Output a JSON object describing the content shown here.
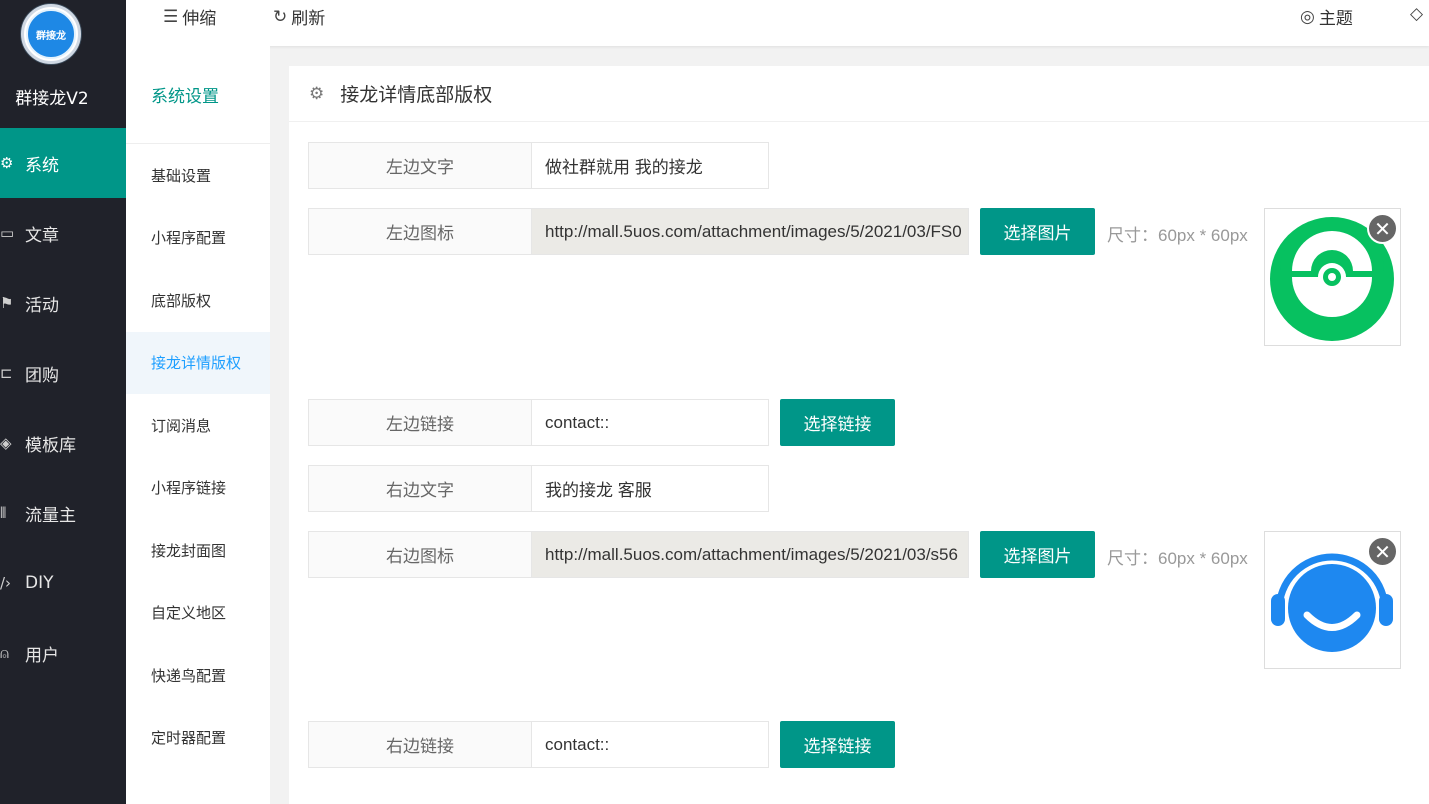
{
  "app": {
    "logo_text": "群接龙",
    "name": "群接龙V2"
  },
  "nav": [
    {
      "label": "系统",
      "icon": "gear-icon",
      "active": true
    },
    {
      "label": "文章",
      "icon": "book-icon"
    },
    {
      "label": "活动",
      "icon": "flag-icon"
    },
    {
      "label": "团购",
      "icon": "cart-icon"
    },
    {
      "label": "模板库",
      "icon": "layers-icon"
    },
    {
      "label": "流量主",
      "icon": "chart-icon"
    },
    {
      "label": "DIY",
      "icon": "code-icon"
    },
    {
      "label": "用户",
      "icon": "user-icon"
    }
  ],
  "topbar": {
    "collapse": "伸缩",
    "refresh": "刷新",
    "theme": "主题"
  },
  "submenu": {
    "title": "系统设置",
    "items": [
      "基础设置",
      "小程序配置",
      "底部版权",
      "接龙详情版权",
      "订阅消息",
      "小程序链接",
      "接龙封面图",
      "自定义地区",
      "快递鸟配置",
      "定时器配置"
    ]
  },
  "card": {
    "title": "接龙详情底部版权",
    "left_text": {
      "label": "左边文字",
      "value": "做社群就用 我的接龙"
    },
    "left_icon": {
      "label": "左边图标",
      "value": "http://mall.5uos.com/attachment/images/5/2021/03/FS0",
      "button": "选择图片",
      "hint": "尺寸：60px * 60px"
    },
    "left_link": {
      "label": "左边链接",
      "value": "contact::",
      "button": "选择链接"
    },
    "right_text": {
      "label": "右边文字",
      "value": "我的接龙 客服"
    },
    "right_icon": {
      "label": "右边图标",
      "value": "http://mall.5uos.com/attachment/images/5/2021/03/s56",
      "button": "选择图片",
      "hint": "尺寸：60px * 60px"
    },
    "right_link": {
      "label": "右边链接",
      "value": "contact::",
      "button": "选择链接"
    }
  },
  "colors": {
    "accent": "#009688",
    "sidebar": "#20222a",
    "green_icon": "#07c160",
    "blue_icon": "#1e88f0"
  }
}
